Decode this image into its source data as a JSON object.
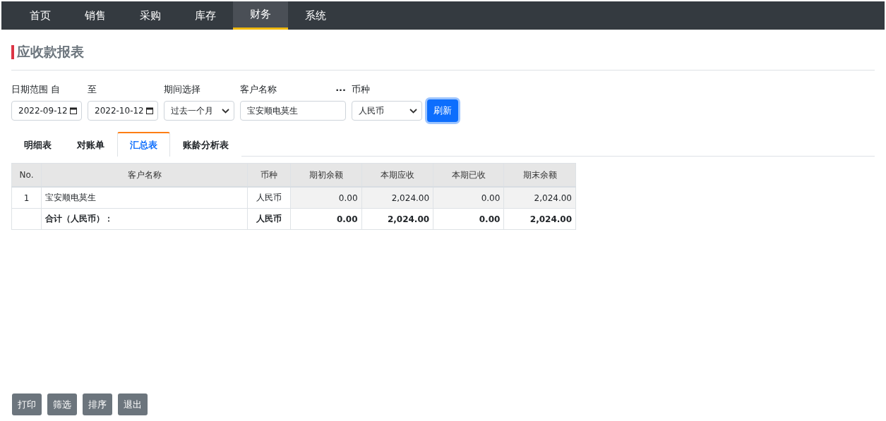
{
  "nav": [
    {
      "label": "首页",
      "selected": false
    },
    {
      "label": "销售",
      "selected": false
    },
    {
      "label": "采购",
      "selected": false
    },
    {
      "label": "库存",
      "selected": false
    },
    {
      "label": "财务",
      "selected": true
    },
    {
      "label": "系统",
      "selected": false
    }
  ],
  "page_title": "应收款报表",
  "filters": {
    "date_label": "日期范围 自",
    "date_from": "2022-09-12",
    "to_label": "至",
    "date_to": "2022-10-12",
    "period_label": "期间选择",
    "period": "过去一个月",
    "customer_label": "客户名称",
    "customer_more": "···",
    "customer": "宝安顺电莫生",
    "currency_label": "币种",
    "currency": "人民币",
    "refresh": "刷新"
  },
  "tabs": [
    {
      "label": "明细表",
      "selected": false
    },
    {
      "label": "对账单",
      "selected": false
    },
    {
      "label": "汇总表",
      "selected": true
    },
    {
      "label": "账龄分析表",
      "selected": false
    }
  ],
  "table": {
    "columns": [
      "No.",
      "客户名称",
      "币种",
      "期初余额",
      "本期应收",
      "本期已收",
      "期末余额"
    ],
    "rows": [
      {
        "kind": "data",
        "cells": [
          "1",
          "宝安顺电莫生",
          "人民币",
          "0.00",
          "2,024.00",
          "0.00",
          "2,024.00"
        ]
      },
      {
        "kind": "total",
        "cells": [
          "",
          "合计（人民币）：",
          "人民币",
          "0.00",
          "2,024.00",
          "0.00",
          "2,024.00"
        ]
      }
    ]
  },
  "actions": [
    "打印",
    "筛选",
    "排序",
    "退出"
  ]
}
